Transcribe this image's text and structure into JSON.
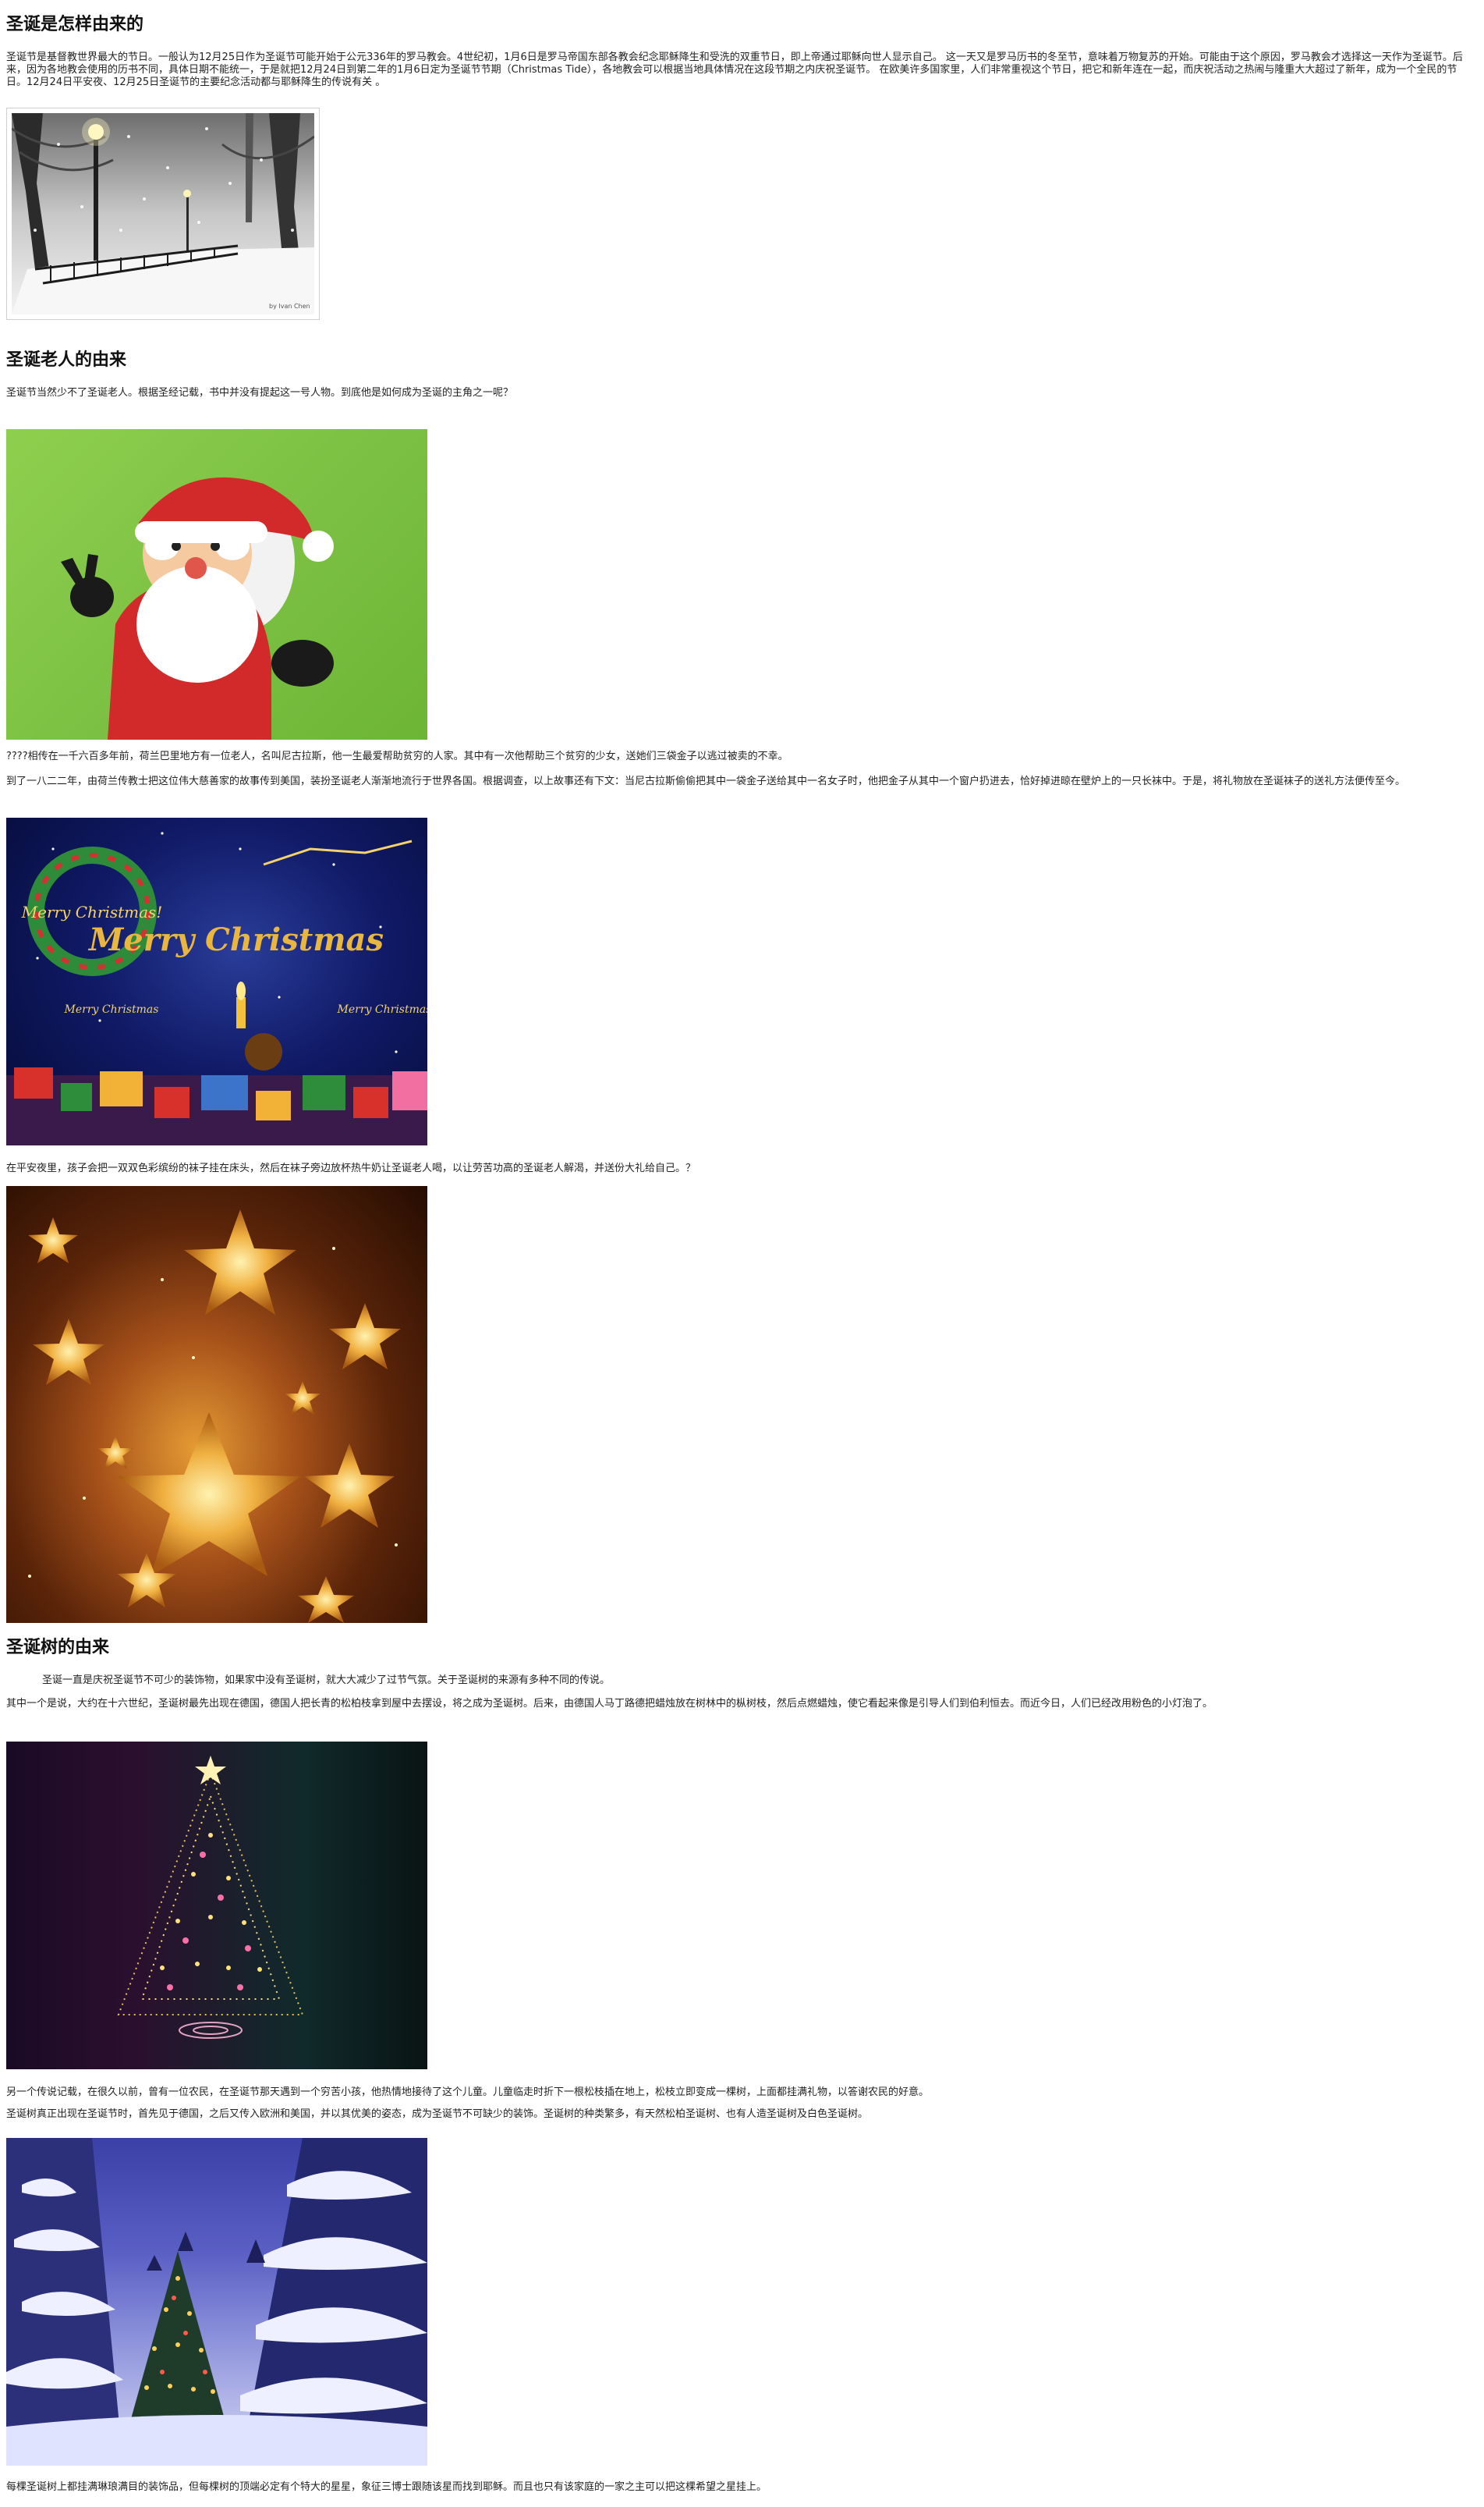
{
  "sections": [
    {
      "title": "圣诞是怎样由来的",
      "paragraphs": [
        "圣诞节是基督教世界最大的节日。一般认为12月25日作为圣诞节可能开始于公元336年的罗马教会。4世纪初，1月6日是罗马帝国东部各教会纪念耶稣降生和受洗的双重节日，即上帝通过耶稣向世人显示自己。 这一天又是罗马历书的冬至节，意味着万物复苏的开始。可能由于这个原因，罗马教会才选择这一天作为圣诞节。后来，因为各地教会使用的历书不同，具体日期不能统一，于是就把12月24日到第二年的1月6日定为圣诞节节期（Christmas Tide），各地教会可以根据当地具体情况在这段节期之内庆祝圣诞节。 在欧美许多国家里，人们非常重视这个节日，把它和新年连在一起，而庆祝活动之热闹与隆重大大超过了新年，成为一个全民的节日。12月24日平安夜、12月25日圣诞节的主要纪念活动都与耶稣降生的传说有关 。"
      ],
      "images": [
        {
          "name": "snowy-park-photo",
          "caption": "by Ivan Chen"
        }
      ]
    },
    {
      "title": "圣诞老人的由来",
      "paragraphs": [
        "圣诞节当然少不了圣诞老人。根据圣经记载，书中并没有提起这一号人物。到底他是如何成为圣诞的主角之一呢？",
        "????相传在一千六百多年前，荷兰巴里地方有一位老人，名叫尼古拉斯，他一生最爱帮助贫穷的人家。其中有一次他帮助三个贫穷的少女，送她们三袋金子以逃过被卖的不幸。",
        "到了一八二二年，由荷兰传教士把这位伟大慈善家的故事传到美国，装扮圣诞老人渐渐地流行于世界各国。根据调查，以上故事还有下文：当尼古拉斯偷偷把其中一袋金子送给其中一名女子时，他把金子从其中一个窗户扔进去，恰好掉进晾在壁炉上的一只长袜中。于是，将礼物放在圣诞袜子的送礼方法便传至今。",
        "在平安夜里，孩子会把一双双色彩缤纷的袜子挂在床头，然后在袜子旁边放杯热牛奶让圣诞老人喝，以让劳苦功高的圣诞老人解渴，并送份大礼给自己。？"
      ],
      "images": [
        {
          "name": "santa-claus-image"
        },
        {
          "name": "merry-christmas-card",
          "texts": [
            "Merry Christmas!",
            "Merry Christmas",
            "Merry Christmas",
            "Merry Christmas"
          ]
        },
        {
          "name": "golden-stars-image"
        }
      ]
    },
    {
      "title": "圣诞树的由来",
      "paragraphs": [
        "圣诞一直是庆祝圣诞节不可少的装饰物，如果家中没有圣诞树，就大大减少了过节气氛。关于圣诞树的来源有多种不同的传说。",
        "其中一个是说，大约在十六世纪，圣诞树最先出现在德国，德国人把长青的松柏枝拿到屋中去摆设，将之成为圣诞树。后来，由德国人马丁路德把蜡烛放在树林中的枞树枝，然后点燃蜡烛，使它看起来像是引导人们到伯利恒去。而近今日，人们已经改用粉色的小灯泡了。",
        "另一个传说记载，在很久以前，曾有一位农民，在圣诞节那天遇到一个穷苦小孩，他热情地接待了这个儿童。儿童临走时折下一根松枝插在地上，松枝立即变成一棵树，上面都挂满礼物，以答谢农民的好意。",
        "圣诞树真正出现在圣诞节时，首先见于德国，之后又传入欧洲和美国，并以其优美的姿态，成为圣诞节不可缺少的装饰。圣诞树的种类繁多，有天然松柏圣诞树、也有人造圣诞树及白色圣诞树。",
        "每棵圣诞树上都挂满琳琅满目的装饰品，但每棵树的顶端必定有个特大的星星，象征三博士跟随该星而找到耶稣。而且也只有该家庭的一家之主可以把这棵希望之星挂上。"
      ],
      "images": [
        {
          "name": "lit-christmas-tree-image"
        },
        {
          "name": "snowy-forest-tree-image"
        }
      ]
    }
  ]
}
